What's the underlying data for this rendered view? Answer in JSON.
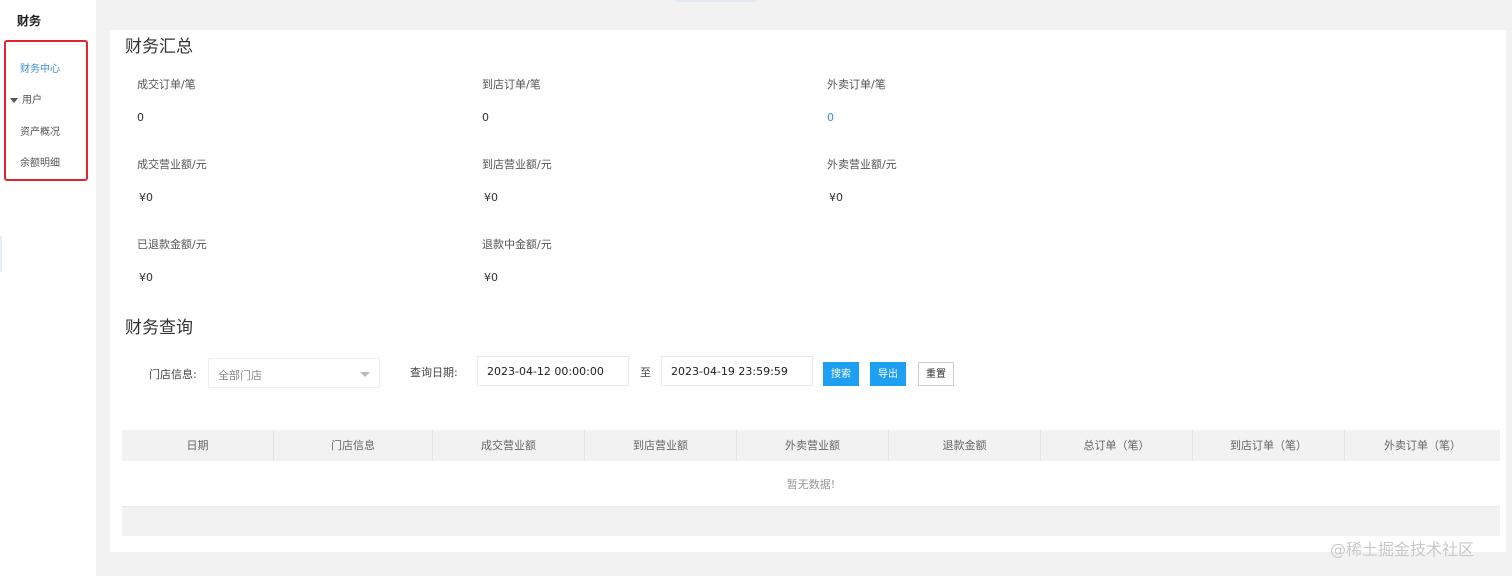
{
  "sidebar": {
    "title": "财务",
    "items": [
      {
        "label": "财务中心",
        "active": true
      },
      {
        "label": "用户",
        "group": true
      },
      {
        "label": "资产概况"
      },
      {
        "label": "余额明细"
      }
    ]
  },
  "summary": {
    "title": "财务汇总",
    "stats": [
      {
        "label": "成交订单/笔",
        "value": "0"
      },
      {
        "label": "到店订单/笔",
        "value": "0"
      },
      {
        "label": "外卖订单/笔",
        "value": "0"
      },
      {
        "label": "成交营业额/元",
        "value": "¥0"
      },
      {
        "label": "到店营业额/元",
        "value": "¥0"
      },
      {
        "label": "外卖营业额/元",
        "value": "¥0"
      },
      {
        "label": "已退款金额/元",
        "value": "¥0"
      },
      {
        "label": "退款中金额/元",
        "value": "¥0"
      }
    ]
  },
  "query": {
    "title": "财务查询",
    "store_label": "门店信息:",
    "store_value": "全部门店",
    "date_label": "查询日期:",
    "date_start": "2023-04-12 00:00:00",
    "date_sep": "至",
    "date_end": "2023-04-19 23:59:59",
    "search_btn": "搜索",
    "export_btn": "导出",
    "reset_btn": "重置"
  },
  "table": {
    "columns": [
      "日期",
      "门店信息",
      "成交营业额",
      "到店营业额",
      "外卖营业额",
      "退款金额",
      "总订单（笔）",
      "到店订单（笔）",
      "外卖订单（笔）"
    ],
    "empty_text": "暂无数据!"
  },
  "watermark": "@稀土掘金技术社区",
  "colors": {
    "accent": "#1e9ff2",
    "link": "#3a8ee6",
    "highlight": "#e0252f"
  }
}
